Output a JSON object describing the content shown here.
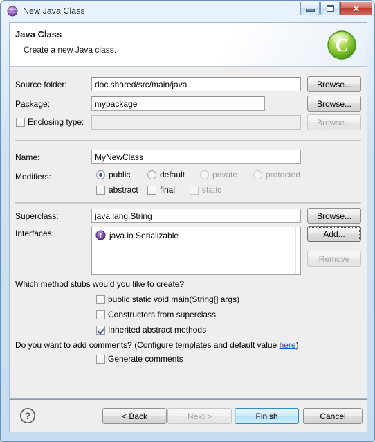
{
  "window": {
    "title": "New Java Class",
    "title_icon": "java-wizard-icon",
    "controls": {
      "minimize": "minimize-icon",
      "maximize": "maximize-icon",
      "close": "✕"
    }
  },
  "banner": {
    "title": "Java Class",
    "subtitle": "Create a new Java class.",
    "icon": "java-class-green-c-icon"
  },
  "form": {
    "source_folder": {
      "label": "Source folder:",
      "value": "doc.shared/src/main/java",
      "browse": "Browse..."
    },
    "package": {
      "label": "Package:",
      "value": "mypackage",
      "browse": "Browse..."
    },
    "enclosing_type": {
      "label": "Enclosing type:",
      "value": "",
      "checked": false,
      "browse": "Browse...",
      "enabled": false
    },
    "name": {
      "label": "Name:",
      "value": "MyNewClass"
    },
    "modifiers": {
      "label": "Modifiers:",
      "radios": [
        {
          "label": "public",
          "checked": true,
          "enabled": true
        },
        {
          "label": "default",
          "checked": false,
          "enabled": true
        },
        {
          "label": "private",
          "checked": false,
          "enabled": false
        },
        {
          "label": "protected",
          "checked": false,
          "enabled": false
        }
      ],
      "checkboxes": [
        {
          "label": "abstract",
          "checked": false,
          "enabled": true
        },
        {
          "label": "final",
          "checked": false,
          "enabled": true
        },
        {
          "label": "static",
          "checked": false,
          "enabled": false
        }
      ]
    },
    "superclass": {
      "label": "Superclass:",
      "value": "java.lang.String",
      "browse": "Browse..."
    },
    "interfaces": {
      "label": "Interfaces:",
      "items": [
        {
          "text": "java.io.Serializable",
          "icon": "interface-icon"
        }
      ],
      "add": "Add...",
      "remove": "Remove",
      "remove_enabled": false
    }
  },
  "stubs": {
    "question": "Which method stubs would you like to create?",
    "options": [
      {
        "label": "public static void main(String[] args)",
        "checked": false
      },
      {
        "label": "Constructors from superclass",
        "checked": false
      },
      {
        "label": "Inherited abstract methods",
        "checked": true
      }
    ]
  },
  "comments": {
    "question_pre": "Do you want to add comments? (Configure templates and default value ",
    "link": "here",
    "question_post": ")",
    "option": {
      "label": "Generate comments",
      "checked": false
    }
  },
  "footer": {
    "help_icon": "help-question-icon",
    "buttons": [
      {
        "label": "< Back",
        "enabled": true,
        "default": false
      },
      {
        "label": "Next >",
        "enabled": false,
        "default": false
      },
      {
        "label": "Finish",
        "enabled": true,
        "default": true
      },
      {
        "label": "Cancel",
        "enabled": true,
        "default": false
      }
    ]
  },
  "colors": {
    "accent": "#2c8bd0",
    "link": "#1858b8",
    "panel": "#efeeee",
    "frame": "#6a90b8",
    "close_button": "#b93c32",
    "class_icon": "#6cbf2a",
    "interface_icon": "#6f3f9e"
  }
}
